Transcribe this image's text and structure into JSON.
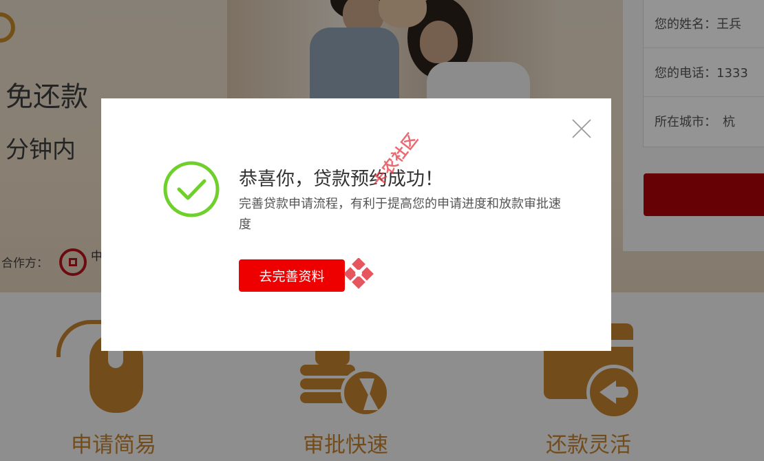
{
  "hero": {
    "headline": "免还款",
    "subheadline": "分钟内",
    "partner_label": "合作方：",
    "partner_name": "中"
  },
  "form": {
    "rows": [
      {
        "label": "您的姓名：王兵"
      },
      {
        "label": "您的电话：1333"
      },
      {
        "label": "所在城市：　杭"
      }
    ]
  },
  "features": [
    {
      "label": "申请简易",
      "icon": "mouse-icon"
    },
    {
      "label": "审批快速",
      "icon": "coins-lightning-icon"
    },
    {
      "label": "还款灵活",
      "icon": "wallet-return-icon"
    }
  ],
  "modal": {
    "title": "恭喜你，贷款预约成功！",
    "description": "完善贷款申请流程，有利于提高您的申请进度和放款审批速度",
    "button_label": "去完善资料",
    "icons": {
      "close": "close-icon",
      "success": "check-circle-icon"
    }
  },
  "watermark": {
    "text": "卡农社区"
  },
  "colors": {
    "overlay": "rgba(0,0,0,0.42)",
    "accent_red": "#e00000",
    "success_green": "#6fcf2b",
    "feature_orange": "#c7842f",
    "form_button_red": "#b0040a"
  }
}
